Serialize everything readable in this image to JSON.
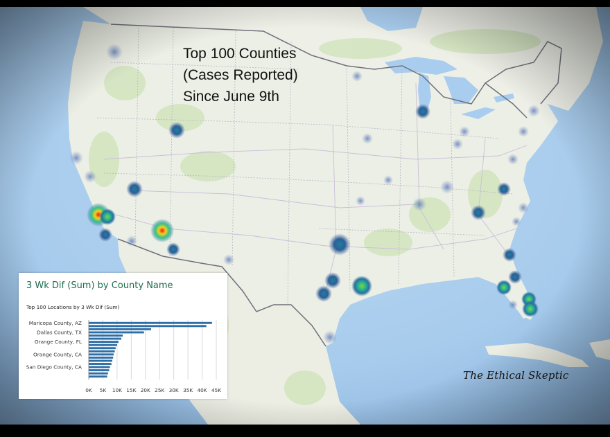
{
  "map": {
    "title_lines": [
      "Top 100 Counties",
      "(Cases Reported)",
      "Since June 9th"
    ],
    "watermark": "The Ethical Skeptic",
    "colors": {
      "ocean": "#a9cdee",
      "land": "#eceee6",
      "heat_low": "#2f6fa0",
      "heat_mid": "#1fb8a0",
      "heat_high": "#e8341c"
    }
  },
  "panel": {
    "title": "3 Wk Dif (Sum) by County Name",
    "subtitle": "Top 100 Locations   by 3 Wk Dif (Sum)"
  },
  "chart_data": {
    "type": "bar",
    "orientation": "horizontal",
    "title": "",
    "xlabel": "",
    "ylabel": "",
    "xlim": [
      0,
      45000
    ],
    "x_ticks": [
      "0K",
      "5K",
      "10K",
      "15K",
      "20K",
      "25K",
      "30K",
      "35K",
      "40K",
      "45K"
    ],
    "grid": true,
    "categories": [
      "Maricopa County, AZ",
      "",
      "",
      "Dallas County, TX",
      "",
      "",
      "Orange County, FL",
      "",
      "",
      "",
      "Orange County, CA",
      "",
      "",
      "",
      "San Diego County, CA",
      "",
      "",
      ""
    ],
    "category_labels_shown": [
      "Maricopa County, AZ",
      "Dallas County, TX",
      "Orange County, FL",
      "Orange County, CA",
      "San Diego County, CA"
    ],
    "values": [
      43500,
      41500,
      22000,
      19500,
      12000,
      11500,
      10500,
      10000,
      9500,
      9200,
      8800,
      8600,
      8300,
      8000,
      7500,
      7200,
      6800,
      6500
    ],
    "color": "#2e6ea6"
  }
}
